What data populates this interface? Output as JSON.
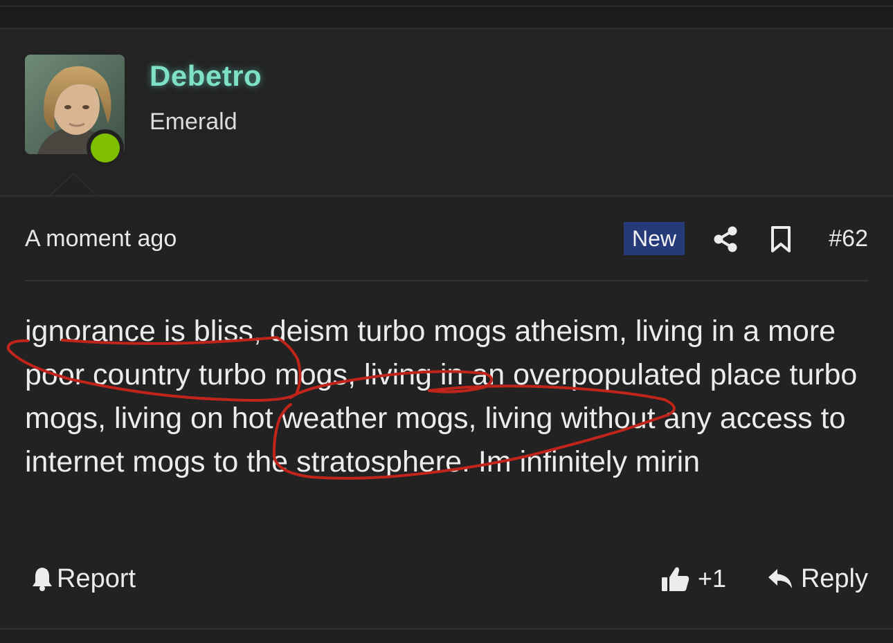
{
  "author": {
    "name": "Debetro",
    "rank": "Emerald",
    "online_color": "#7ec000",
    "name_color": "#7fe0c8"
  },
  "meta": {
    "timestamp": "A moment ago",
    "badge": "New",
    "badge_color": "#263a7a",
    "share_icon": "share-icon",
    "bookmark_icon": "bookmark-icon",
    "post_number": "#62"
  },
  "post": {
    "body": "ignorance is bliss, deism turbo mogs atheism, living in a more poor country turbo mogs, living in an overpopulated place turbo mogs, living on hot weather mogs, living without any access to internet mogs to the stratosphere. Im infinitely mirin",
    "annotation_color": "#c0241b"
  },
  "footer": {
    "report_label": "Report",
    "like_count": "+1",
    "reply_label": "Reply"
  }
}
